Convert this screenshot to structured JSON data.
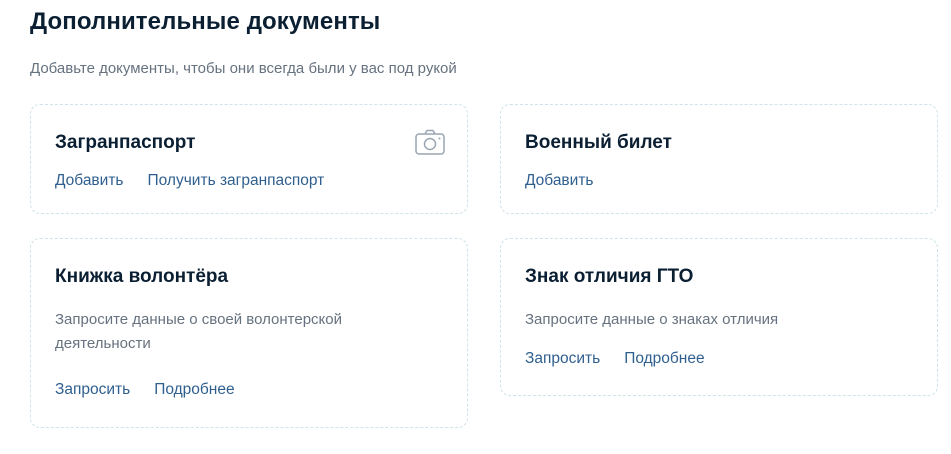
{
  "section": {
    "title": "Дополнительные документы",
    "subtitle": "Добавьте документы, чтобы они всегда были у вас под рукой"
  },
  "cards": {
    "passport": {
      "title": "Загранпаспорт",
      "icon": "camera-icon",
      "links": [
        "Добавить",
        "Получить загранпаспорт"
      ]
    },
    "military": {
      "title": "Военный билет",
      "links": [
        "Добавить"
      ]
    },
    "volunteer": {
      "title": "Книжка волонтёра",
      "description": "Запросите данные о своей волонтерской деятельности",
      "links": [
        "Запросить",
        "Подробнее"
      ]
    },
    "gto": {
      "title": "Знак отличия ГТО",
      "description": "Запросите данные о знаках отличия",
      "links": [
        "Запросить",
        "Подробнее"
      ]
    }
  },
  "colors": {
    "text": "#0b1f33",
    "secondary": "#66727f",
    "link": "#2f5f8f",
    "border": "#cfe3ea"
  }
}
